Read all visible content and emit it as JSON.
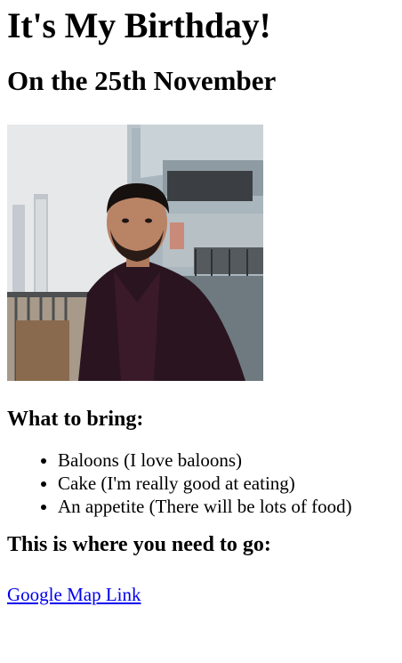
{
  "title": "It's My Birthday!",
  "date_heading": "On the 25th November",
  "photo": {
    "alt": ""
  },
  "bring": {
    "heading": "What to bring:",
    "items": [
      "Baloons (I love baloons)",
      "Cake (I'm really good at eating)",
      "An appetite (There will be lots of food)"
    ]
  },
  "directions": {
    "heading": "This is where you need to go:",
    "link_text": "Google Map Link"
  },
  "colors": {
    "link": "#0000ee",
    "text": "#000000",
    "background": "#ffffff"
  }
}
